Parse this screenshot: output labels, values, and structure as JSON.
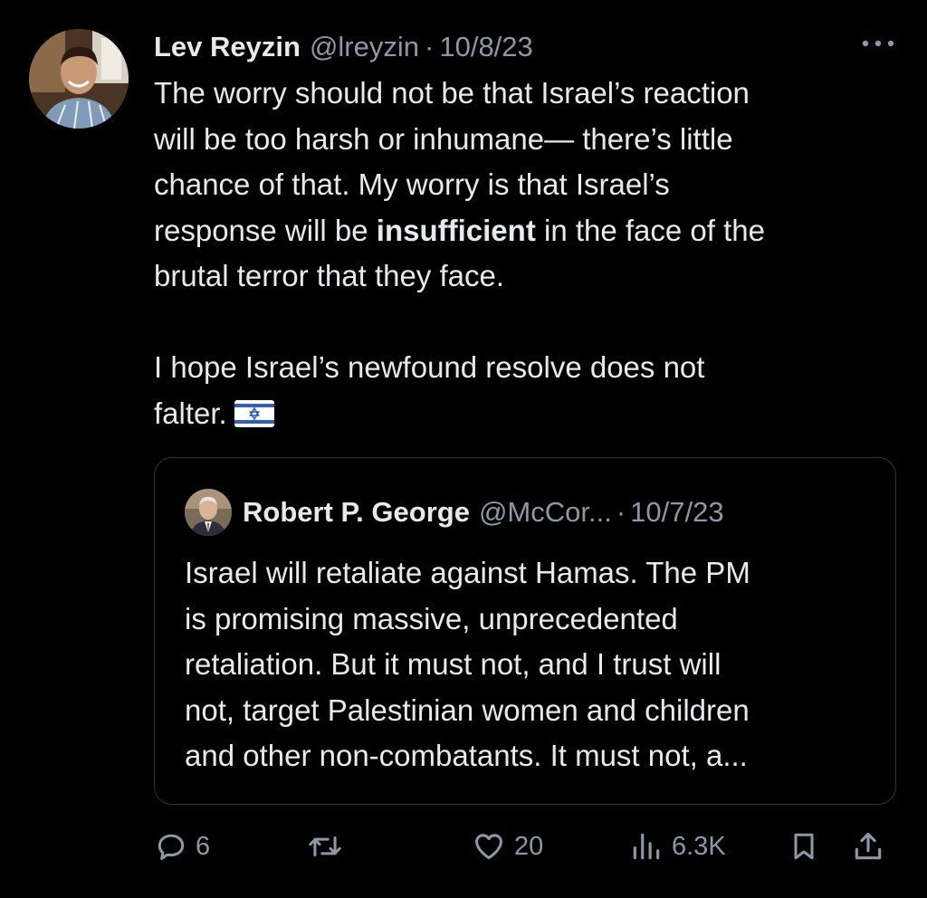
{
  "tweet": {
    "author_name": "Lev Reyzin",
    "author_handle": "@lreyzin",
    "separator": "·",
    "date": "10/8/23",
    "body": {
      "line1": "The worry should not be that Israel’s reaction",
      "line2": "will be too harsh or inhumane— there’s little",
      "line3": "chance of that. My worry is that Israel’s",
      "line4_before": "response will be ",
      "line4_bold": "insufficient",
      "line4_after": " in the face of the",
      "line5": "brutal terror that they face.",
      "line6": "I hope Israel’s newfound resolve does not",
      "line7": "falter."
    }
  },
  "quote": {
    "author_name": "Robert P. George",
    "author_handle": "@McCor...",
    "separator": "·",
    "date": "10/7/23",
    "lines": [
      "Israel will retaliate against Hamas. The PM",
      "is promising massive, unprecedented",
      "retaliation. But it must not, and I trust will",
      "not, target Palestinian women and children",
      "and other non-combatants. It must not, a..."
    ]
  },
  "actions": {
    "replies": "6",
    "likes": "20",
    "views": "6.3K"
  },
  "icons": {
    "more": "more-horizontal-icon",
    "reply": "reply-bubble-icon",
    "retweet": "retweet-icon",
    "like": "heart-icon",
    "views": "bar-chart-icon",
    "bookmark": "bookmark-icon",
    "share": "share-upload-icon",
    "flag": "israel-flag-emoji"
  },
  "colors": {
    "background": "#000000",
    "text": "#e7e9ea",
    "secondary_text": "#8b98a5",
    "border": "#2f3336"
  }
}
